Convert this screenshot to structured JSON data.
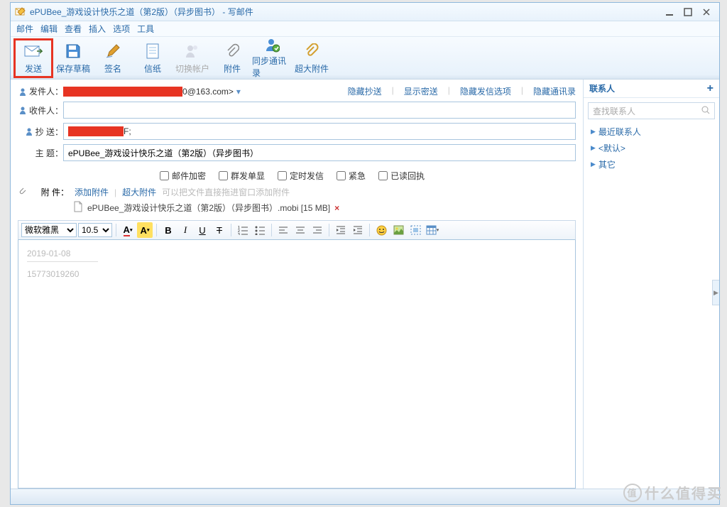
{
  "window": {
    "title": "ePUBee_游戏设计快乐之道（第2版）（异步图书） - 写邮件"
  },
  "menu": {
    "mail": "邮件",
    "edit": "编辑",
    "view": "查看",
    "insert": "插入",
    "options": "选项",
    "tools": "工具"
  },
  "toolbar": {
    "send": "发送",
    "save_draft": "保存草稿",
    "sign": "签名",
    "paper": "信纸",
    "switch_account": "切换帐户",
    "attach": "附件",
    "sync_contacts": "同步通讯录",
    "big_attach": "超大附件"
  },
  "fields": {
    "sender_label": "发件人：",
    "sender_suffix": "0@163.com>",
    "to_label": "收件人：",
    "cc_label": "抄  送：",
    "cc_value_suffix": "F;",
    "subject_label": "主  题：",
    "subject_value": "ePUBee_游戏设计快乐之道（第2版）（异步图书）"
  },
  "header_links": {
    "hide_cc": "隐藏抄送",
    "show_bcc": "显示密送",
    "hide_send_opts": "隐藏发信选项",
    "hide_contacts": "隐藏通讯录"
  },
  "options": {
    "encrypt": "邮件加密",
    "mass_single": "群发单显",
    "scheduled": "定时发信",
    "urgent": "紧急",
    "receipt": "已读回执"
  },
  "attach": {
    "label": "附  件：",
    "add": "添加附件",
    "big": "超大附件",
    "hint": "可以把文件直接拖进窗口添加附件",
    "file_name": "ePUBee_游戏设计快乐之道（第2版）（异步图书）.mobi [15 MB]"
  },
  "editor": {
    "font": "微软雅黑",
    "size": "10.5",
    "body_date": "2019-01-08",
    "body_num": "15773019260"
  },
  "sidebar": {
    "title": "联系人",
    "search_placeholder": "查找联系人",
    "items": {
      "recent": "最近联系人",
      "default": "<默认>",
      "other": "其它"
    }
  },
  "watermark": "什么值得买"
}
